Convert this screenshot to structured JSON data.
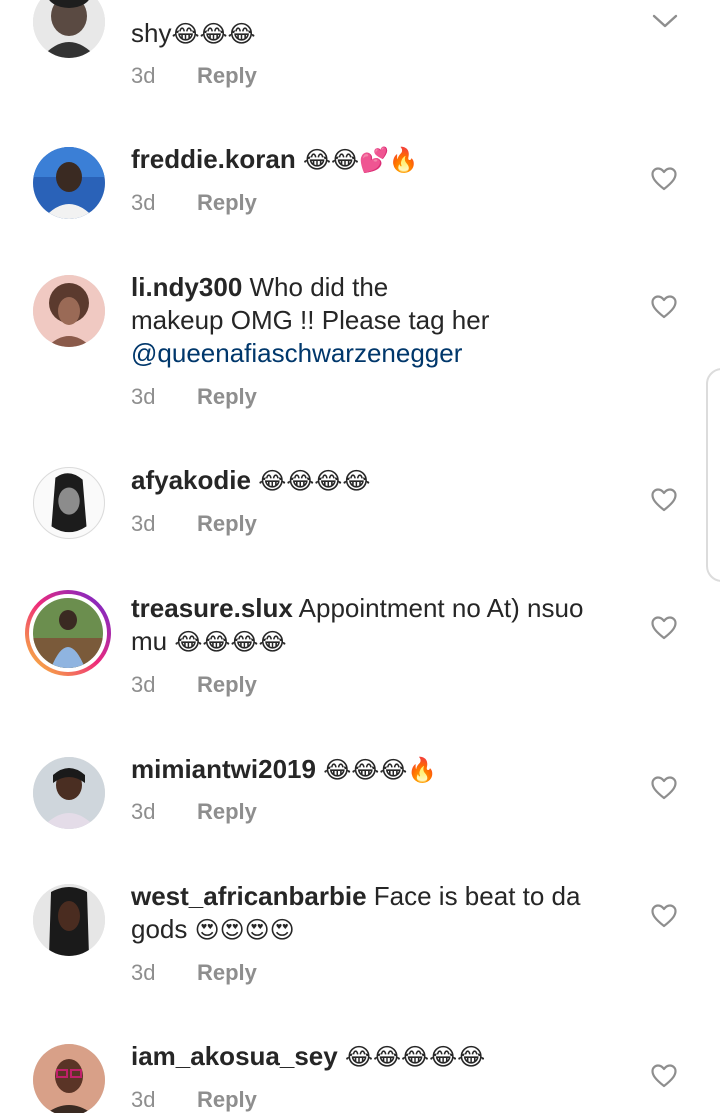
{
  "comments": [
    {
      "username": "",
      "text": "shy",
      "emojis": "😂😂😂",
      "time": "3d",
      "reply": "Reply"
    },
    {
      "username": "freddie.koran",
      "text": "",
      "emojis": "😂😂💕🔥",
      "time": "3d",
      "reply": "Reply"
    },
    {
      "username": "li.ndy300",
      "text_line1": " Who did the",
      "text_line2": "makeup OMG !! Please tag her",
      "mention": "@queenafiaschwarzenegger",
      "time": "3d",
      "reply": "Reply"
    },
    {
      "username": "afyakodie",
      "text": "",
      "emojis": "😂😂😂😂",
      "time": "3d",
      "reply": "Reply"
    },
    {
      "username": "treasure.slux",
      "text_line1": " Appointment no At) nsuo",
      "text_line2": "mu ",
      "emojis": "😂😂😂😂",
      "time": "3d",
      "reply": "Reply"
    },
    {
      "username": "mimiantwi2019",
      "text": "",
      "emojis": "😂😂😂🔥",
      "time": "3d",
      "reply": "Reply"
    },
    {
      "username": "west_africanbarbie",
      "text_line1": " Face is beat to da",
      "text_line2": "gods ",
      "emojis": "😍😍😍😍",
      "time": "3d",
      "reply": "Reply"
    },
    {
      "username": "iam_akosua_sey",
      "text": "",
      "emojis": "😂😂😂😂😂",
      "time": "3d",
      "reply": "Reply"
    }
  ],
  "colors": {
    "username": "#262626",
    "mention": "#00376b",
    "meta": "#8e8e8e",
    "story_ring": [
      "#f9ce34",
      "#ee2a7b",
      "#6228d7"
    ]
  },
  "icons": {
    "like": "heart-outline-icon",
    "collapse": "chevron-down-icon"
  }
}
